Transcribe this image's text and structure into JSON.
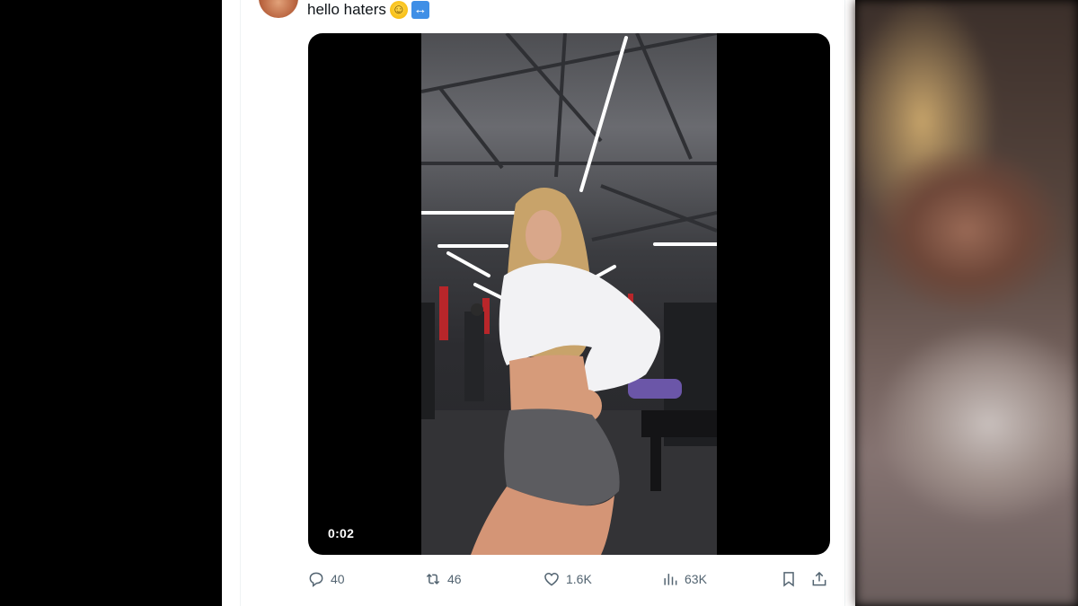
{
  "tweet": {
    "text": "hello haters",
    "emoji_1": "slightly-smiling-face",
    "emoji_2": "left-right-arrow"
  },
  "video": {
    "time": "0:02"
  },
  "actions": {
    "replies": "40",
    "reposts": "46",
    "likes": "1.6K",
    "views": "63K"
  },
  "icons": [
    "reply-icon",
    "repost-icon",
    "like-icon",
    "views-icon",
    "bookmark-icon",
    "share-icon"
  ]
}
